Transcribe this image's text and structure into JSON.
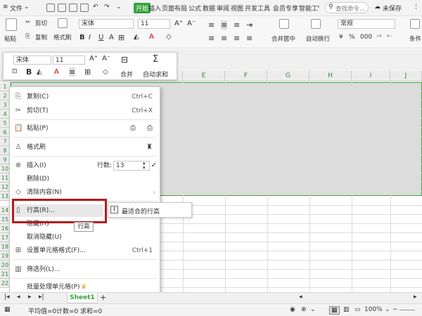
{
  "titlebar": {
    "file_menu": "文件",
    "tab_start": "开始",
    "tabs": [
      "插入",
      "页面布局",
      "公式",
      "数据",
      "审阅",
      "视图",
      "开发工具",
      "会员专享",
      "智能工"
    ],
    "search_placeholder": "查找命令...",
    "cloud_status": "未保存"
  },
  "ribbon": {
    "paste": "粘贴",
    "cut": "剪切",
    "copy": "复制",
    "format_painter": "格式刷",
    "font_name": "宋体",
    "font_size": "11",
    "merge_center": "合并居中",
    "wrap_text": "自动换行",
    "number_format": "常规",
    "conditional": "条件"
  },
  "minitoolbar": {
    "font_name": "宋体",
    "font_size": "11",
    "bold": "B",
    "merge": "合并",
    "autosum": "自动求和"
  },
  "columns": [
    "E",
    "F",
    "G",
    "H",
    "I",
    "J"
  ],
  "rows": [
    "1",
    "2",
    "3",
    "4",
    "5",
    "6",
    "7",
    "8",
    "9",
    "10",
    "11",
    "12",
    "13",
    "14",
    "15",
    "16",
    "17",
    "18",
    "19",
    "20",
    "21",
    "22"
  ],
  "context_menu": {
    "copy": "复制(C)",
    "copy_shortcut": "Ctrl+C",
    "cut": "剪切(T)",
    "cut_shortcut": "Ctrl+X",
    "paste": "粘贴(P)",
    "format_painter": "格式刷",
    "insert": "插入(I)",
    "rows_label": "行数:",
    "rows_value": "13",
    "delete": "删除(D)",
    "clear": "清除内容(N)",
    "row_height": "行高(R)...",
    "hide": "隐藏(H)",
    "unhide": "取消隐藏(U)",
    "format_cells": "设置单元格格式(F)...",
    "format_cells_shortcut": "Ctrl+1",
    "filter": "筛选列(L)...",
    "batch": "批量处理单元格(P)"
  },
  "submenu": {
    "best_fit": "最适合的行高"
  },
  "tooltip": {
    "text": "行高"
  },
  "sheet": {
    "tab": "Sheet1",
    "add": "+"
  },
  "status": {
    "average": "平均值=0",
    "count": "计数=0",
    "sum": "求和=0",
    "zoom": "100%"
  },
  "colors": {
    "accent": "#36a43a",
    "highlight_frame": "#b31b1b",
    "selection_fill": "#dcdcdc"
  }
}
